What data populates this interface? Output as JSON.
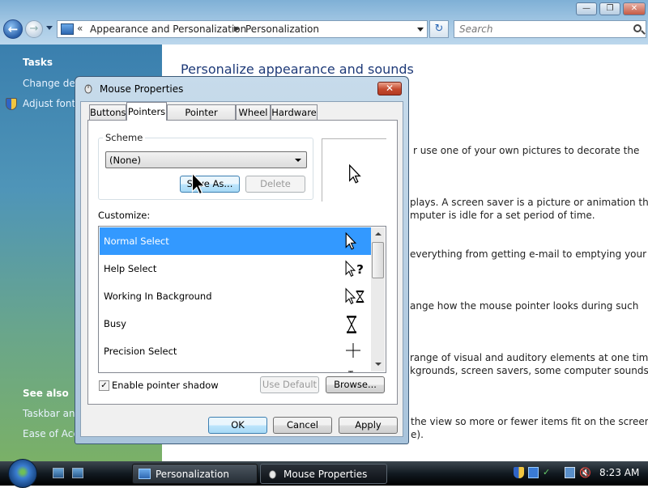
{
  "explorer": {
    "breadcrumb": [
      "Appearance and Personalization",
      "Personalization"
    ],
    "search_placeholder": "Search",
    "page_title": "Personalize appearance and sounds",
    "left_pane": {
      "tasks_heading": "Tasks",
      "task_links": [
        "Change desk",
        "Adjust font s"
      ],
      "see_also_heading": "See also",
      "see_also_links": [
        "Taskbar and",
        "Ease of Acce"
      ]
    },
    "content_fragments": [
      "r use one of your own pictures to decorate the",
      "plays. A screen saver is a picture or animation that",
      "mputer is idle for a set period of time.",
      "everything from getting e-mail to emptying your",
      "ange how the mouse pointer looks during such",
      "range of visual and auditory elements at one time",
      "kgrounds, screen savers, some computer sounds, and",
      "the view so more or fewer items fit on the screen.",
      "e)."
    ]
  },
  "dialog": {
    "title": "Mouse Properties",
    "tabs": [
      "Buttons",
      "Pointers",
      "Pointer Options",
      "Wheel",
      "Hardware"
    ],
    "active_tab": "Pointers",
    "scheme_label": "Scheme",
    "scheme_value": "(None)",
    "save_as_label": "Save As...",
    "delete_label": "Delete",
    "customize_label": "Customize:",
    "pointers": [
      {
        "label": "Normal Select",
        "icon": "arrow-cursor-icon",
        "selected": true
      },
      {
        "label": "Help Select",
        "icon": "help-cursor-icon"
      },
      {
        "label": "Working In Background",
        "icon": "working-cursor-icon"
      },
      {
        "label": "Busy",
        "icon": "hourglass-cursor-icon"
      },
      {
        "label": "Precision Select",
        "icon": "crosshair-cursor-icon"
      }
    ],
    "shadow_label": "Enable pointer shadow",
    "shadow_checked": true,
    "use_default_label": "Use Default",
    "browse_label": "Browse...",
    "ok_label": "OK",
    "cancel_label": "Cancel",
    "apply_label": "Apply"
  },
  "taskbar": {
    "buttons": [
      "Personalization",
      "Mouse Properties"
    ],
    "active_button": "Mouse Properties",
    "clock": "8:23 AM"
  },
  "colors": {
    "selection": "#3399ff",
    "title_text": "#1e3a78"
  }
}
